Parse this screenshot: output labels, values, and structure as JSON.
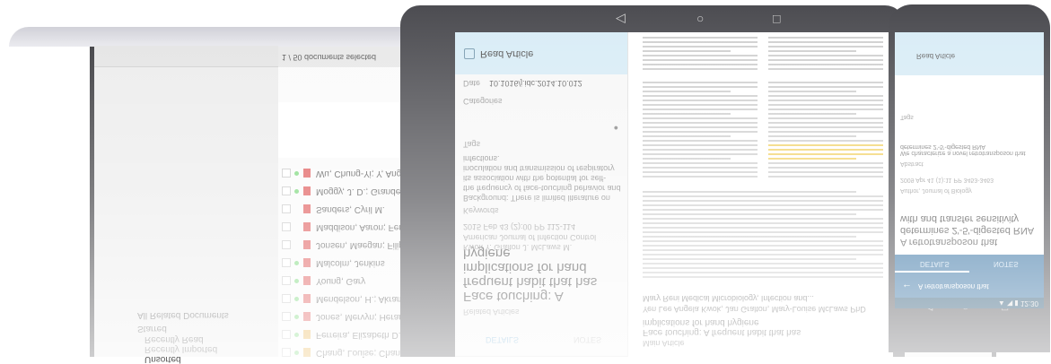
{
  "laptop": {
    "count_label": "1 / 50 documents selected",
    "sidebar": [
      {
        "label": "All Related Documents",
        "indent": 0
      },
      {
        "label": "Starred",
        "indent": 0
      },
      {
        "label": "Recently Read",
        "indent": 1
      },
      {
        "label": "Recently Imported",
        "indent": 1
      },
      {
        "label": "Unsorted",
        "indent": 1
      }
    ],
    "list": [
      "Wu, Chung-Yi; Y, Ang...",
      "Moggy, J. D.; Grande, P...",
      "Sanders, Cyril M.",
      "Maddison, Aaron; Fenwi...",
      "Jonsen, Maegan; Filip...",
      "Malcolm, Jenkins",
      "Young, Gary",
      "Mendelson, H.; Akrami...",
      "Jones, Mervyn; Heran...",
      "Ferreira, Elizabeth D.; W...",
      "Chang, Louise; Chang..."
    ]
  },
  "tablet": {
    "nav": {
      "back": "◁",
      "home": "○",
      "recent": "□"
    },
    "left": {
      "title": "Read Article",
      "date_label": "Date",
      "date_value": "10.1016/j.idc.2014.10.012",
      "categories_label": "Categories",
      "tags_label": "Tags",
      "abstract_label": "Abstract",
      "abstract": "Background: There is limited literature on the frequency of face-touching behavior and its association with the potential for self-inoculation and transmission of respiratory infections.",
      "keywords_label": "Keywords",
      "published": "2015 Feb 43 (2):00 PP 112-114",
      "authors": "Kwok Y. Gralton J. McLaws M.",
      "journal": "American Journal of Infection Control",
      "article_title": "Face touching: A frequent habit that has implications for hand hygiene",
      "open_label": "Related Articles",
      "tabs": [
        "DETAILS",
        "NOTES"
      ]
    },
    "doc": {
      "journal": "Mary Reni Medical Microbiology, Infection and...",
      "authors": "Yen Lee Angela Kwok, Jan Gralton, Mary-Louise McLaws PhD",
      "title": "Face touching: A frequent habit that has implications for hand hygiene"
    }
  },
  "phone": {
    "status": "▲ ◥ ▮ 12:30",
    "toolbar_title": "A retrotransposon that",
    "tabs": [
      "DETAILS",
      "NOTES"
    ],
    "title": "A retrotransposon that determines 2'-5'-digested RNA with and transfer sensitivity",
    "journal": "Author, Journal of Biology",
    "published": "2009 Apr 41 (1):11 PP 3453-3463",
    "abstract_label": "Abstract",
    "abstract": "We characterize a novel retrotransposon that determines 2'-5'-digested RNA",
    "tags_label": "Tags",
    "bottom_title": "Read Article",
    "nav": {
      "back": "◁",
      "home": "○",
      "recent": "□"
    }
  }
}
